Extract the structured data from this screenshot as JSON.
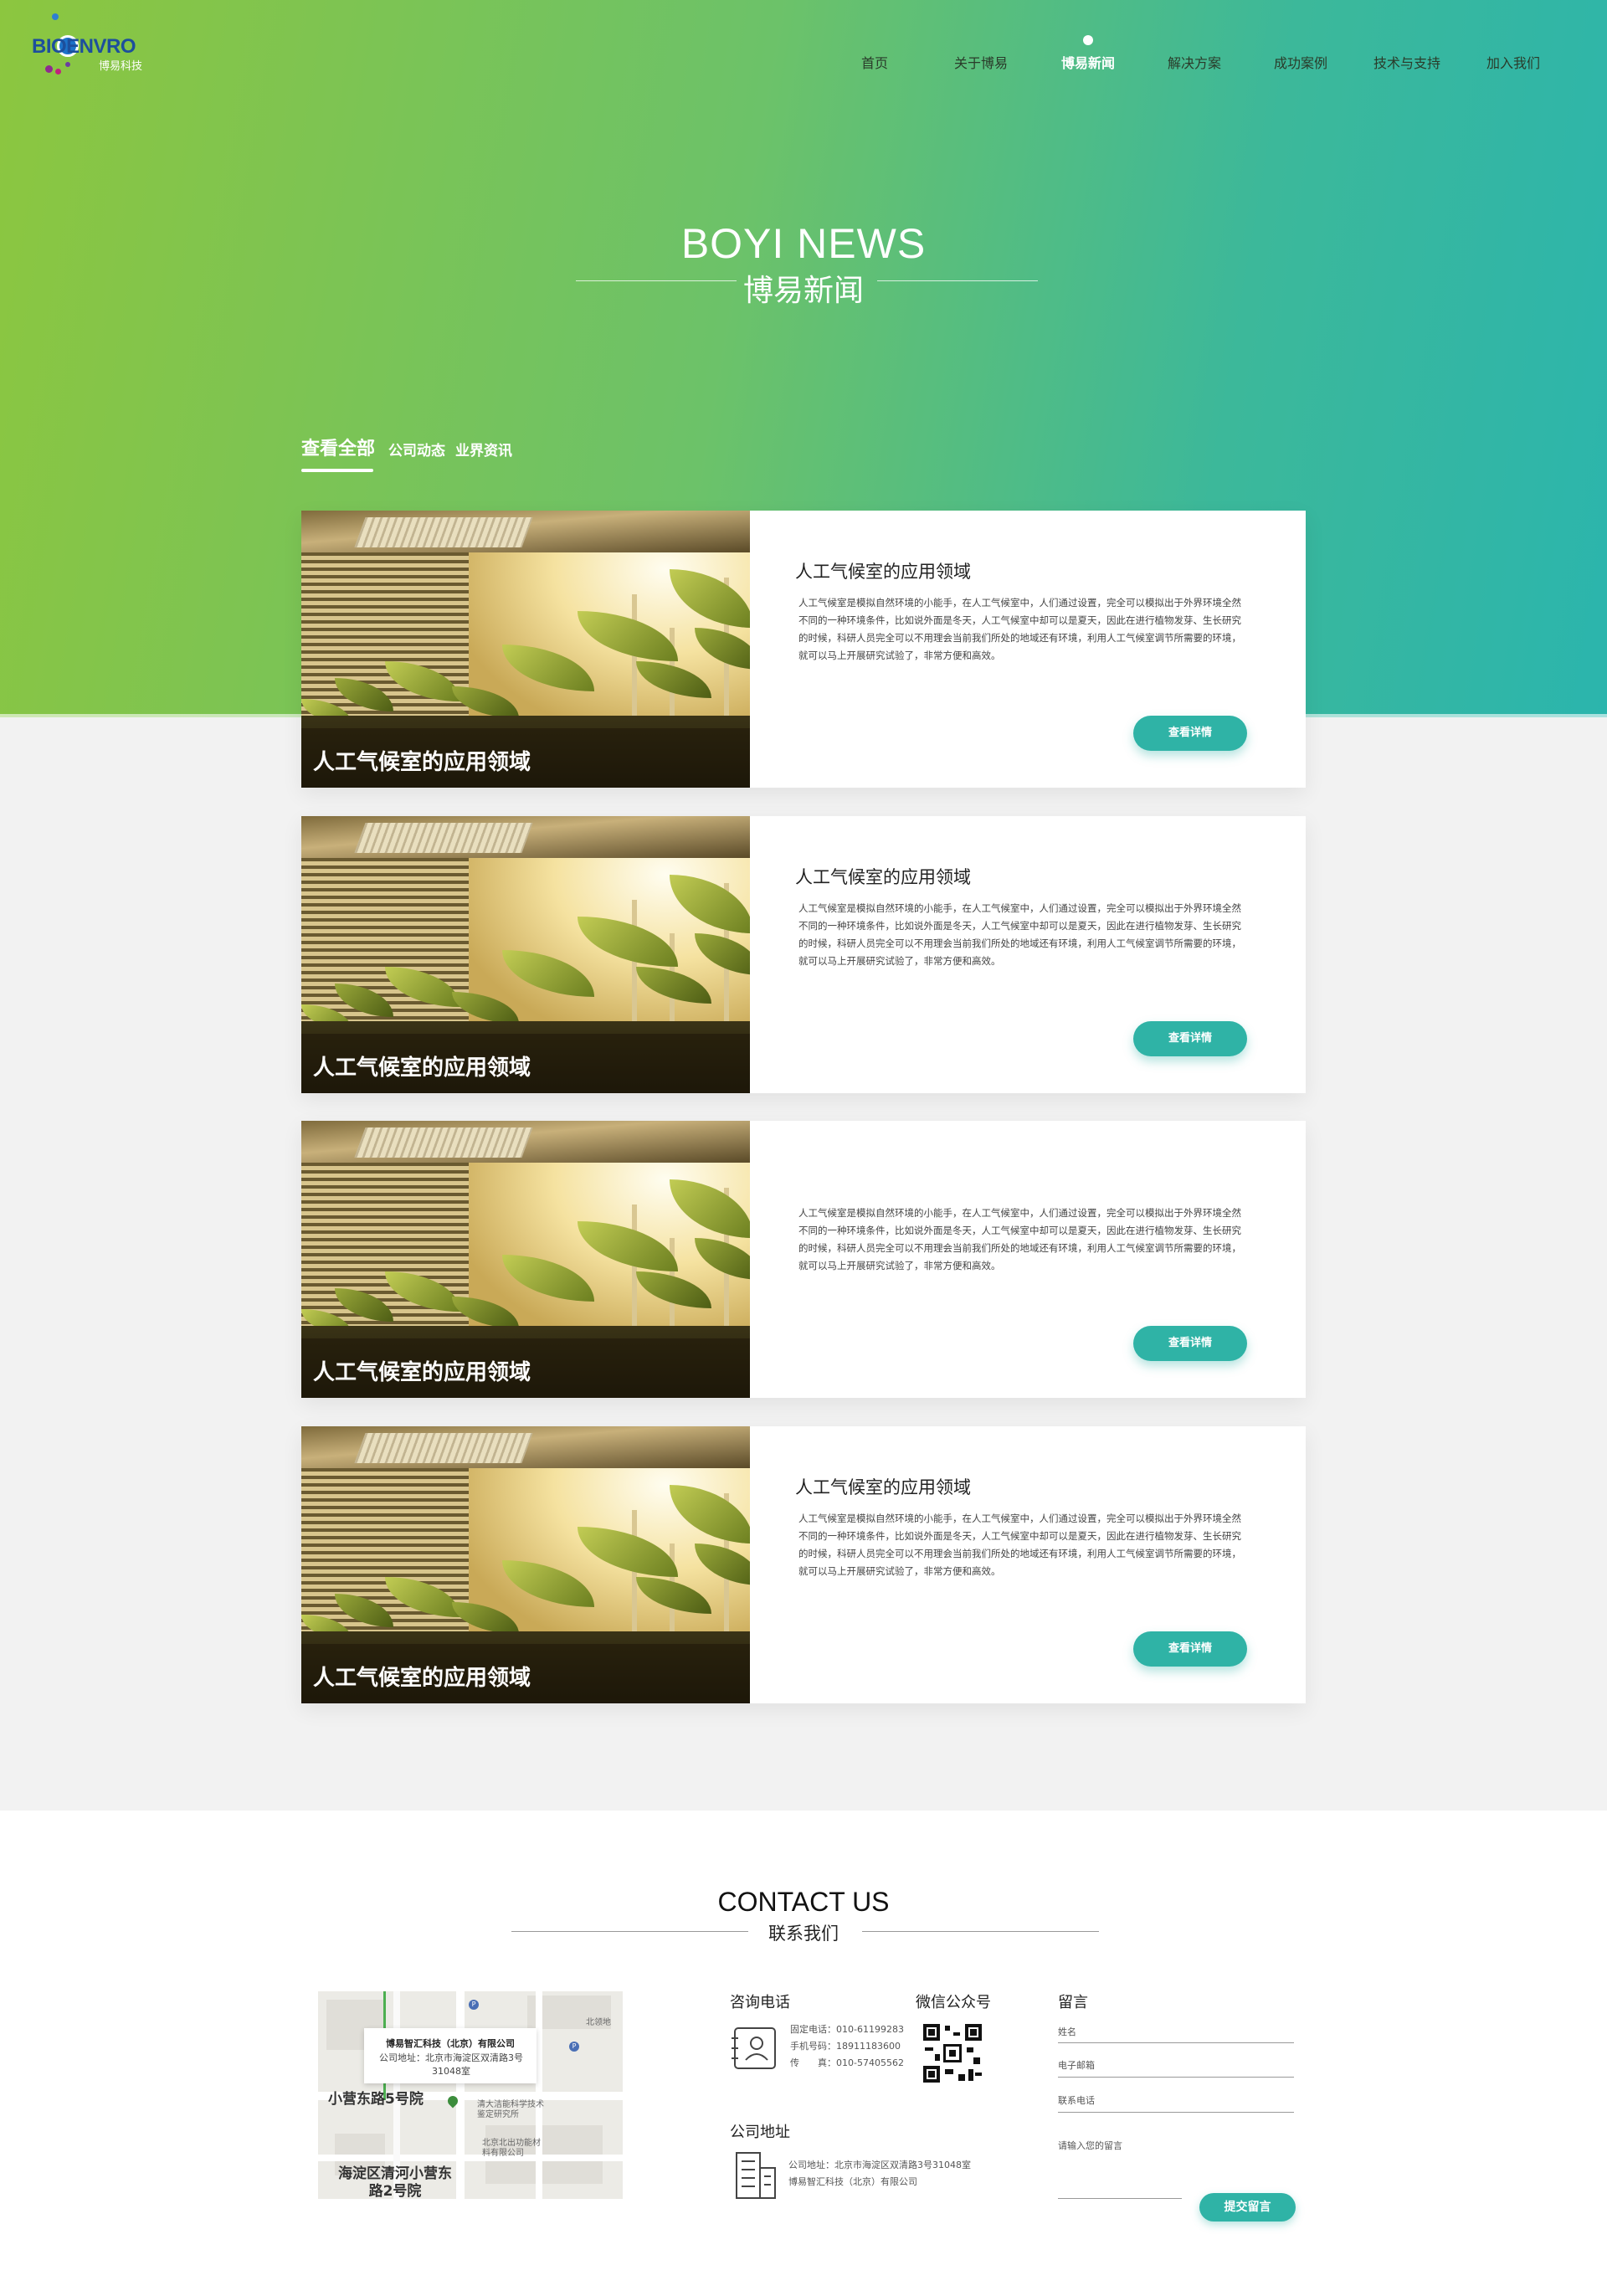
{
  "brand": {
    "logo_text": "BIOENVRO",
    "logo_sub": "博易科技",
    "colors": {
      "accent": "#2fb3a6",
      "gradient_start": "#8cc63f",
      "gradient_end": "#2bb5ad",
      "logo_blue": "#1d4f9c"
    }
  },
  "nav": {
    "items": [
      {
        "label": "首页"
      },
      {
        "label": "关于博易"
      },
      {
        "label": "博易新闻"
      },
      {
        "label": "解决方案"
      },
      {
        "label": "成功案例"
      },
      {
        "label": "技术与支持"
      },
      {
        "label": "加入我们"
      }
    ],
    "active": "博易新闻"
  },
  "hero": {
    "title": "BOYI NEWS",
    "subtitle": "博易新闻"
  },
  "filters": {
    "tabs": [
      {
        "label": "查看全部"
      },
      {
        "label": "公司动态"
      },
      {
        "label": "业界资讯"
      }
    ],
    "active": "查看全部"
  },
  "news": [
    {
      "image_caption": "人工气候室的应用领域",
      "title": "人工气候室的应用领域",
      "description": "人工气候室是模拟自然环境的小能手，在人工气候室中，人们通过设置，完全可以模拟出于外界环境全然不同的一种环境条件，比如说外面是冬天，人工气候室中却可以是夏天，因此在进行植物发芽、生长研究的时候，科研人员完全可以不用理会当前我们所处的地域还有环境，利用人工气候室调节所需要的环境，就可以马上开展研究试验了，非常方便和高效。",
      "button": "查看详情"
    },
    {
      "image_caption": "人工气候室的应用领域",
      "title": "人工气候室的应用领域",
      "description": "人工气候室是模拟自然环境的小能手，在人工气候室中，人们通过设置，完全可以模拟出于外界环境全然不同的一种环境条件，比如说外面是冬天，人工气候室中却可以是夏天，因此在进行植物发芽、生长研究的时候，科研人员完全可以不用理会当前我们所处的地域还有环境，利用人工气候室调节所需要的环境，就可以马上开展研究试验了，非常方便和高效。",
      "button": "查看详情"
    },
    {
      "image_caption": "人工气候室的应用领域",
      "title": "",
      "description": "人工气候室是模拟自然环境的小能手，在人工气候室中，人们通过设置，完全可以模拟出于外界环境全然不同的一种环境条件，比如说外面是冬天，人工气候室中却可以是夏天，因此在进行植物发芽、生长研究的时候，科研人员完全可以不用理会当前我们所处的地域还有环境，利用人工气候室调节所需要的环境，就可以马上开展研究试验了，非常方便和高效。",
      "button": "查看详情"
    },
    {
      "image_caption": "人工气候室的应用领域",
      "title": "人工气候室的应用领域",
      "description": "人工气候室是模拟自然环境的小能手，在人工气候室中，人们通过设置，完全可以模拟出于外界环境全然不同的一种环境条件，比如说外面是冬天，人工气候室中却可以是夏天，因此在进行植物发芽、生长研究的时候，科研人员完全可以不用理会当前我们所处的地域还有环境，利用人工气候室调节所需要的环境，就可以马上开展研究试验了，非常方便和高效。",
      "button": "查看详情"
    }
  ],
  "contact": {
    "title": "CONTACT US",
    "subtitle": "联系我们",
    "map": {
      "company": "博易智汇科技（北京）有限公司",
      "address": "公司地址：北京市海淀区双清路3号31048室",
      "label_1": "小营东路5号院",
      "label_2": "海淀区清河小营东路2号院",
      "poi_1": "北京北出功能材料有限公司",
      "poi_2": "清大洁能科学技术鉴定研究所",
      "poi_3": "北领地"
    },
    "phone": {
      "heading": "咨询电话",
      "fixed": "固定电话：010-61199283",
      "mobile": "手机号码：18911183600",
      "fax": "传　　真：010-57405562",
      "icon": "contact-card-icon"
    },
    "wechat": {
      "heading": "微信公众号"
    },
    "address": {
      "heading": "公司地址",
      "line1": "公司地址：北京市海淀区双清路3号31048室",
      "line2": "博易智汇科技（北京）有限公司",
      "icon": "building-icon"
    },
    "form": {
      "heading": "留言",
      "name": "姓名",
      "email": "电子邮箱",
      "phone": "联系电话",
      "message": "请输入您的留言",
      "submit": "提交留言"
    }
  }
}
